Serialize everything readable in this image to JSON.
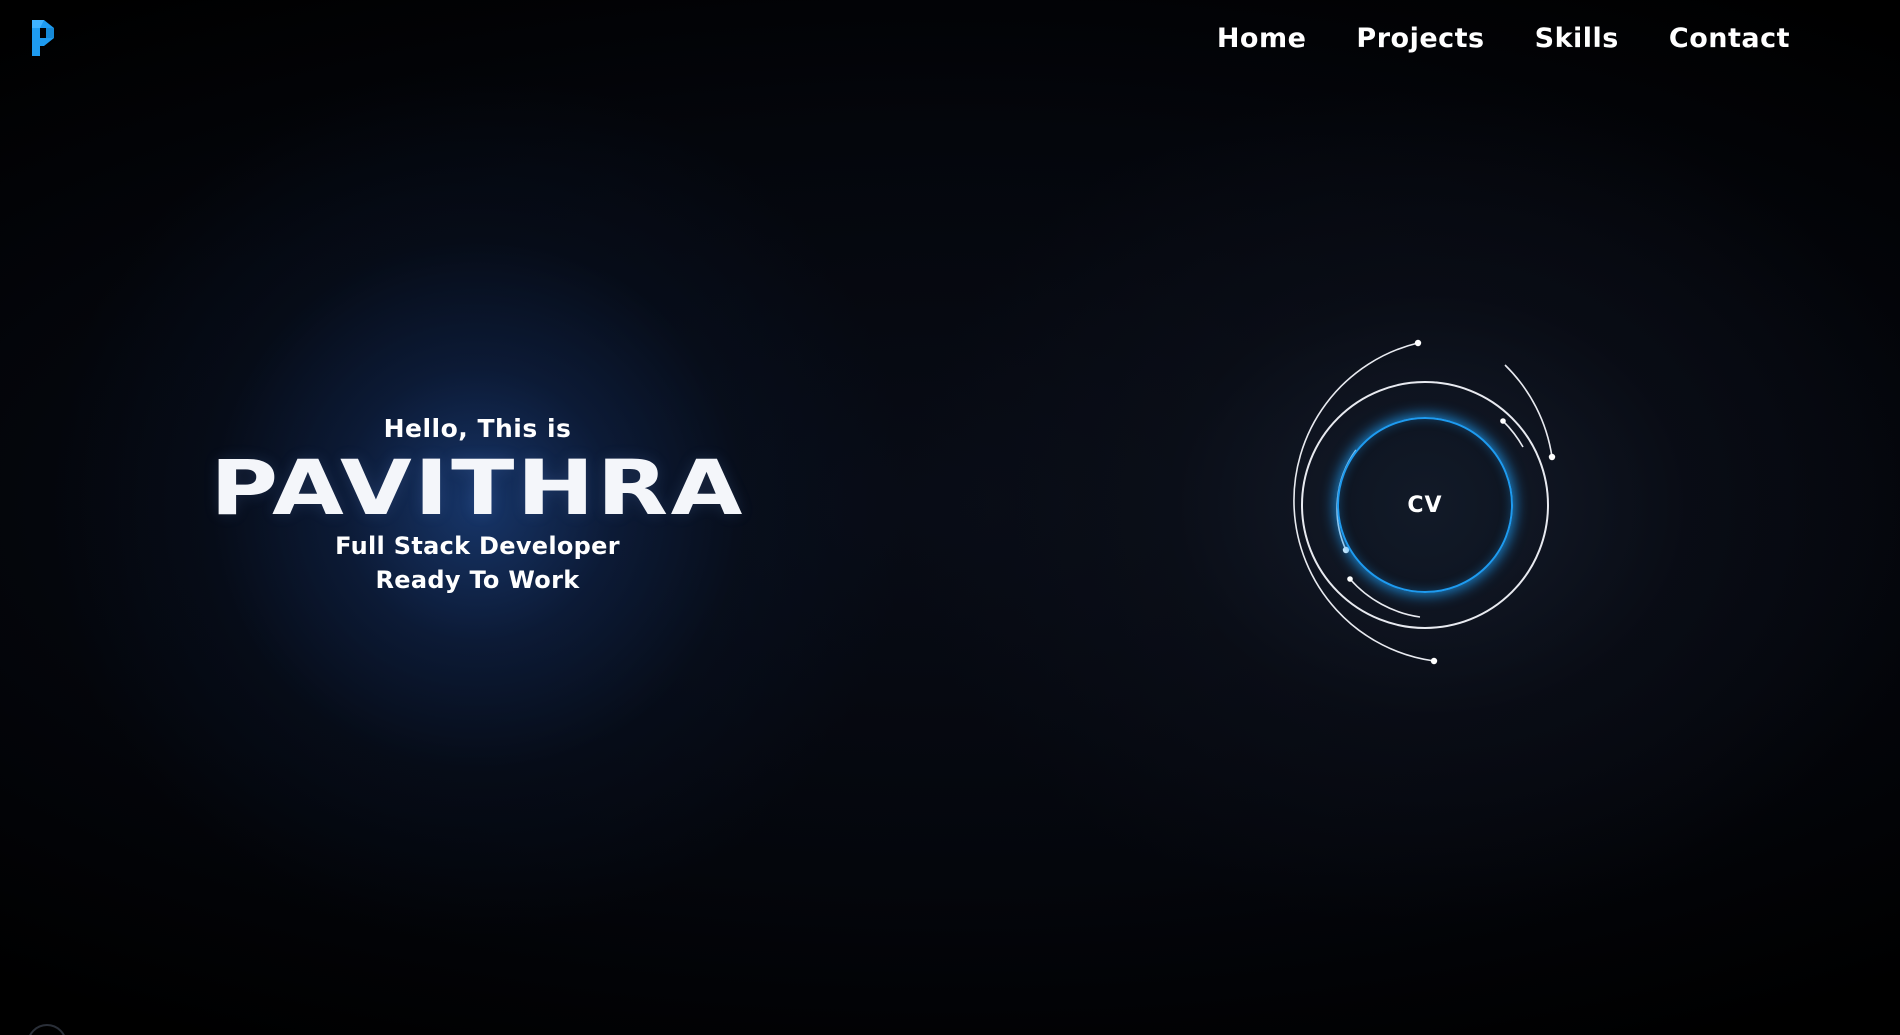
{
  "brand": {
    "logo_icon": "p-logo-icon",
    "accent_color": "#1e9bf0"
  },
  "nav": {
    "items": [
      {
        "label": "Home"
      },
      {
        "label": "Projects"
      },
      {
        "label": "Skills"
      },
      {
        "label": "Contact"
      }
    ]
  },
  "hero": {
    "greeting": "Hello, This is",
    "name": "PAVITHRA",
    "role": "Full Stack Developer",
    "status": "Ready To Work"
  },
  "cv": {
    "label": "CV",
    "glow_color": "#1e9bf0"
  }
}
